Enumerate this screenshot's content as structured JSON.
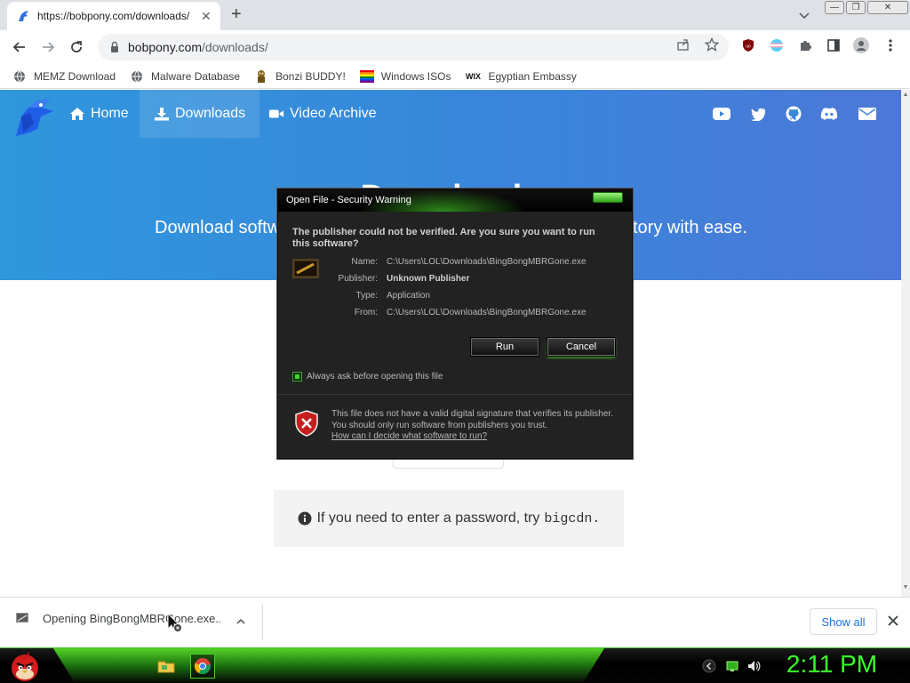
{
  "browser": {
    "tab": {
      "title": "https://bobpony.com/downloads/"
    },
    "omnibox": {
      "host": "bobpony.com",
      "path": "/downloads/"
    },
    "bookmarks": [
      {
        "label": "MEMZ Download",
        "icon": "globe-icon"
      },
      {
        "label": "Malware Database",
        "icon": "globe-icon"
      },
      {
        "label": "Bonzi BUDDY!",
        "icon": "bonzi-icon"
      },
      {
        "label": "Windows ISOs",
        "icon": "windows-flag-icon"
      },
      {
        "label": "Egyptian Embassy",
        "icon": "wix-icon",
        "icon_text": "WIX"
      }
    ],
    "extensions": [
      "ublock-icon",
      "flag-extension-icon",
      "puzzle-icon",
      "sidepanel-icon",
      "profile-icon",
      "menu-icon"
    ]
  },
  "site": {
    "nav": [
      {
        "label": "Home",
        "icon": "home-icon"
      },
      {
        "label": "Downloads",
        "icon": "download-icon",
        "active": true
      },
      {
        "label": "Video Archive",
        "icon": "video-icon"
      }
    ],
    "social": [
      "youtube-icon",
      "twitter-icon",
      "github-icon",
      "discord-icon",
      "mail-icon"
    ],
    "hero": {
      "title": "Downloads",
      "subtitle_left": "Download softw",
      "subtitle_right": "tory with ease."
    },
    "notice": {
      "text": "If you need to enter a password, try",
      "code": "bigcdn."
    }
  },
  "dialog": {
    "title": "Open File - Security Warning",
    "question": "The publisher could not be verified.  Are you sure you want to run this software?",
    "fields": {
      "name_label": "Name:",
      "name_value": "C:\\Users\\LOL\\Downloads\\BingBongMBRGone.exe",
      "publisher_label": "Publisher:",
      "publisher_value": "Unknown Publisher",
      "type_label": "Type:",
      "type_value": "Application",
      "from_label": "From:",
      "from_value": "C:\\Users\\LOL\\Downloads\\BingBongMBRGone.exe"
    },
    "run_label": "Run",
    "cancel_label": "Cancel",
    "checkbox_label": "Always ask before opening this file",
    "checkbox_checked": true,
    "warning": "This file does not have a valid digital signature that verifies its publisher.  You should only run software from publishers you trust.",
    "link": "How can I decide what software to run?"
  },
  "shelf": {
    "download_text": "Opening BingBongMBRGone.exe...",
    "show_all_label": "Show all"
  },
  "taskbar": {
    "clock": "2:11 PM",
    "accent": "#3bff2a"
  }
}
